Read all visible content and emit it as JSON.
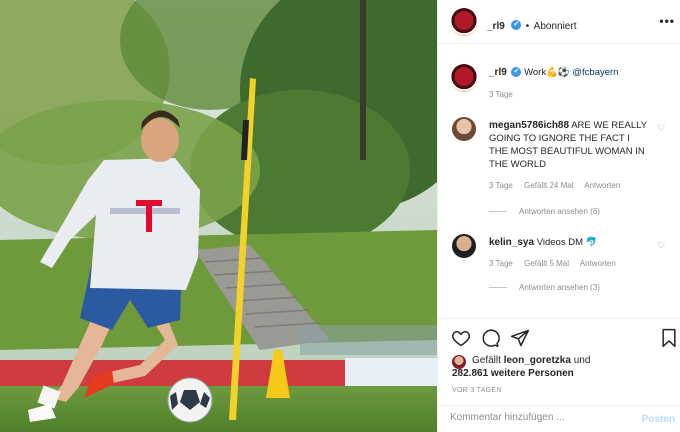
{
  "header": {
    "username": "_rl9",
    "verified_mark": "✔",
    "separator": "•",
    "follow_status": "Abonniert",
    "more": "•••"
  },
  "caption": {
    "username": "_rl9",
    "text": "Work💪⚽ ",
    "mention": "@fcbayern",
    "time": "3 Tage"
  },
  "comments": [
    {
      "username": "megan5786ich88",
      "text": "ARE WE REALLY GOING TO IGNORE THE FACT I THE MOST BEAUTIFUL WOMAN IN THE WORLD",
      "time": "3 Tage",
      "likes": "Gefällt 24 Mal",
      "reply": "Antworten",
      "view_replies": "Antworten ansehen (6)"
    },
    {
      "username": "kelin_sya",
      "text": "Videos DM 🐬",
      "time": "3 Tage",
      "likes": "Gefällt 5 Mal",
      "reply": "Antworten",
      "view_replies": "Antworten ansehen (3)"
    }
  ],
  "footer": {
    "liked_prefix": "Gefällt",
    "liked_by": "leon_goretzka",
    "liked_and": "und",
    "liked_others": "282.861 weitere Personen",
    "time_ago": "VOR 3 TAGEN",
    "comment_placeholder": "Kommentar hinzufügen ...",
    "post_label": "Posten"
  },
  "icons": [
    "heart-icon",
    "comment-icon",
    "share-icon",
    "bookmark-icon",
    "more-icon",
    "verified-icon"
  ],
  "colors": {
    "verified": "#3897f0",
    "link": "#00376b",
    "muted": "#8e8e8e",
    "post_disabled": "#b3dbff"
  }
}
